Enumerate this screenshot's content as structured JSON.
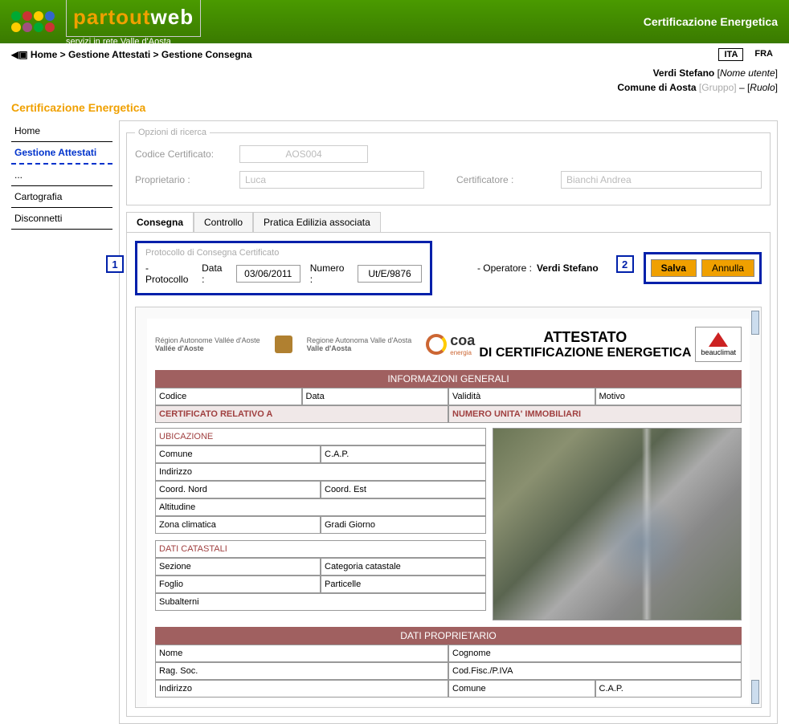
{
  "header": {
    "logo_main1": "partout",
    "logo_main2": "web",
    "logo_sub": "servizi in rete Valle d'Aosta",
    "title": "Certificazione Energetica"
  },
  "breadcrumb": {
    "home": "Home",
    "l1": "Gestione Attestati",
    "l2": "Gestione Consegna"
  },
  "lang": {
    "ita": "ITA",
    "fra": "FRA"
  },
  "user": {
    "name": "Verdi Stefano",
    "name_label": "Nome utente",
    "group_val": "Comune di Aosta",
    "group_label": "Gruppo",
    "role_label": "Ruolo"
  },
  "subtitle": "Certificazione Energetica",
  "sidebar": [
    {
      "label": "Home"
    },
    {
      "label": "Gestione Attestati"
    },
    {
      "label": "..."
    },
    {
      "label": "Cartografia"
    },
    {
      "label": "Disconnetti"
    }
  ],
  "search": {
    "legend": "Opzioni di ricerca",
    "codice_label": "Codice Certificato:",
    "codice_val": "AOS004",
    "prop_label": "Proprietario :",
    "prop_val": "Luca",
    "cert_label": "Certificatore :",
    "cert_val": "Bianchi Andrea"
  },
  "tabs": [
    {
      "label": "Consegna"
    },
    {
      "label": "Controllo"
    },
    {
      "label": "Pratica Edilizia associata"
    }
  ],
  "protocol": {
    "legend": "Protocollo di Consegna Certificato",
    "proto_label": "- Protocollo",
    "data_label": "Data :",
    "data_val": "03/06/2011",
    "numero_label": "Numero :",
    "numero_val": "Ut/E/9876",
    "operatore_label": "- Operatore :",
    "operatore_val": "Verdi Stefano"
  },
  "buttons": {
    "salva": "Salva",
    "annulla": "Annulla"
  },
  "annotations": {
    "one": "1",
    "two": "2"
  },
  "document": {
    "logos": {
      "vda1": "Région Autonome Vallée d'Aoste",
      "vda2": "Regione Autonoma Valle d'Aosta",
      "coa": "coa",
      "coa_sub": "energia",
      "beauclimat": "beauclimat"
    },
    "title1": "ATTESTATO",
    "title2": "DI CERTIFICAZIONE ENERGETICA",
    "band_info": "INFORMAZIONI GENERALI",
    "info_headers": {
      "codice": "Codice",
      "data": "Data",
      "validita": "Validità",
      "motivo": "Motivo"
    },
    "rel_header": "CERTIFICATO RELATIVO A",
    "num_header": "NUMERO UNITA' IMMOBILIARI",
    "ubicazione": {
      "header": "UBICAZIONE",
      "comune": "Comune",
      "cap": "C.A.P.",
      "indirizzo": "Indirizzo",
      "coord_nord": "Coord. Nord",
      "coord_est": "Coord. Est",
      "altitudine": "Altitudine",
      "zona": "Zona climatica",
      "gradi": "Gradi Giorno"
    },
    "catastali": {
      "header": "DATI CATASTALI",
      "sezione": "Sezione",
      "categoria": "Categoria catastale",
      "foglio": "Foglio",
      "particelle": "Particelle",
      "subalterni": "Subalterni"
    },
    "band_prop": "DATI PROPRIETARIO",
    "proprietario": {
      "nome": "Nome",
      "cognome": "Cognome",
      "ragsoc": "Rag. Soc.",
      "codfisc": "Cod.Fisc./P.IVA",
      "indirizzo": "Indirizzo",
      "comune": "Comune",
      "cap": "C.A.P."
    }
  }
}
